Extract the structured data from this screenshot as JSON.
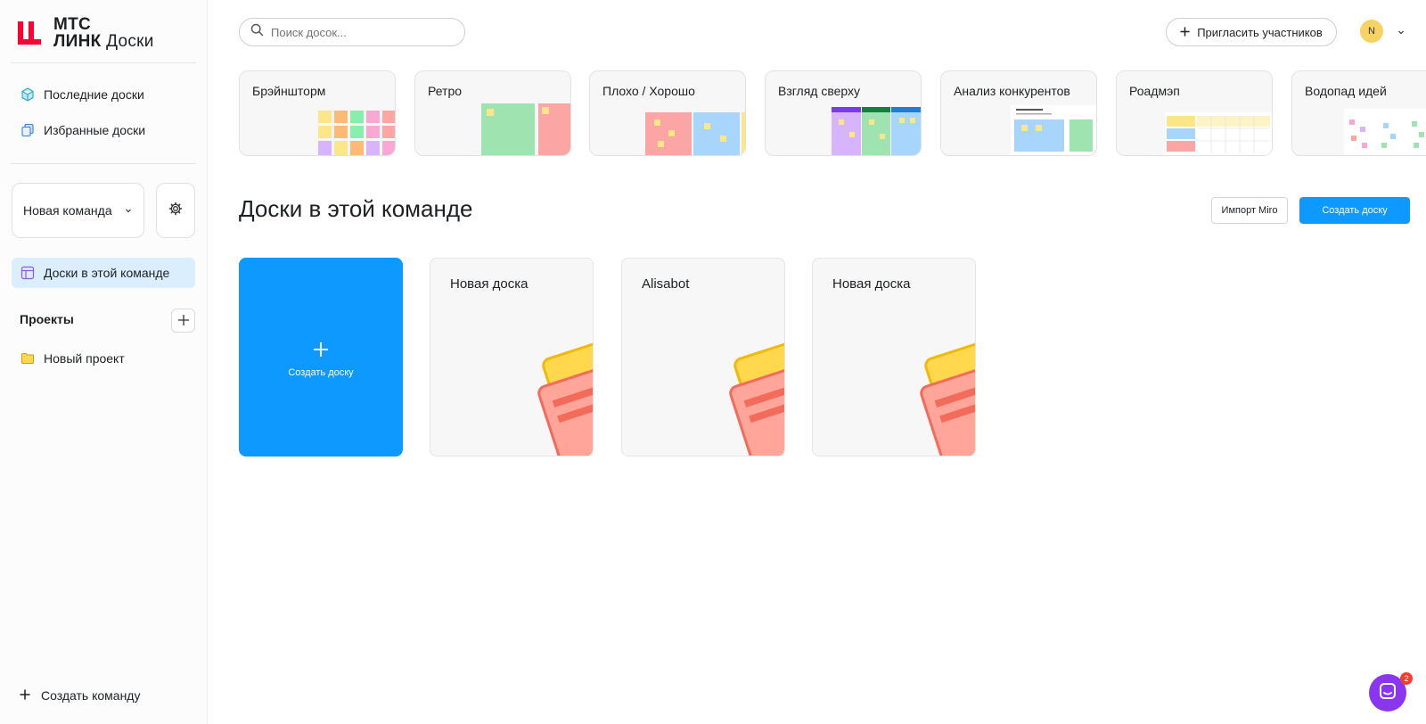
{
  "logo": {
    "line1": "МТС",
    "line2": "ЛИНК",
    "product": "Доски",
    "accent": "#ff0032"
  },
  "sidebar": {
    "nav": [
      {
        "label": "Последние доски",
        "icon": "cube-icon"
      },
      {
        "label": "Избранные доски",
        "icon": "stack-icon"
      }
    ],
    "team": {
      "selected": "Новая команда"
    },
    "team_boards": {
      "label": "Доски в этой команде",
      "icon": "board-layout-icon"
    },
    "projects": {
      "heading": "Проекты",
      "items": [
        {
          "label": "Новый проект",
          "icon": "folder-icon"
        }
      ]
    },
    "create_team": "Создать команду"
  },
  "topbar": {
    "search_placeholder": "Поиск досок...",
    "invite_label": "Пригласить участников",
    "avatar_initial": "N"
  },
  "templates": [
    {
      "title": "Брэйншторм"
    },
    {
      "title": "Ретро"
    },
    {
      "title": "Плохо / Хорошо"
    },
    {
      "title": "Взгляд сверху"
    },
    {
      "title": "Анализ конкурентов"
    },
    {
      "title": "Роадмэп"
    },
    {
      "title": "Водопад идей"
    }
  ],
  "section": {
    "title": "Доски в этой команде",
    "import_label": "Импорт Miro",
    "create_label": "Создать доску"
  },
  "boards": {
    "create_label": "Создать доску",
    "items": [
      {
        "title": "Новая доска"
      },
      {
        "title": "Alisabot"
      },
      {
        "title": "Новая доска"
      }
    ]
  },
  "chat": {
    "badge": "2"
  },
  "colors": {
    "primary": "#0d99ff",
    "active_bg": "#dbeefe",
    "chat": "#8a35f0"
  }
}
